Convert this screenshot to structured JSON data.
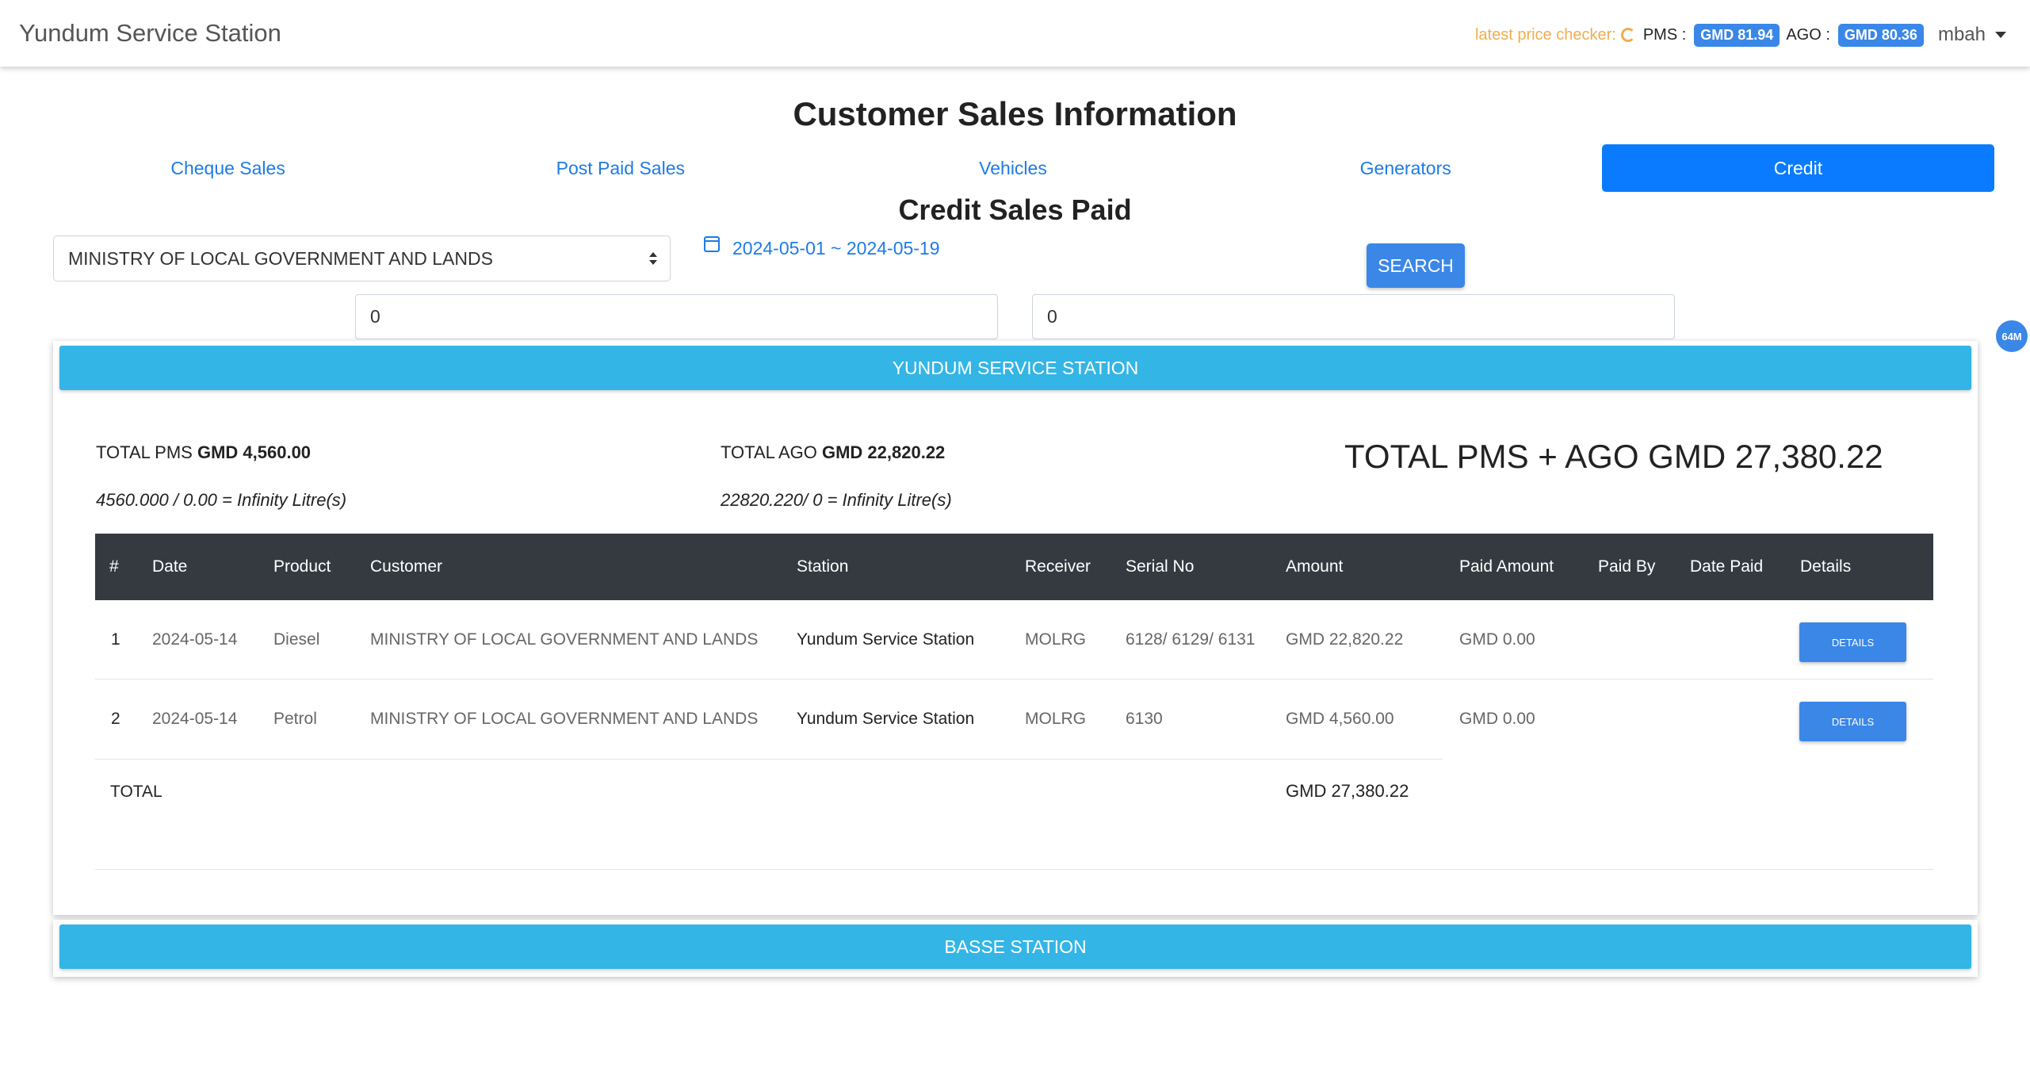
{
  "navbar": {
    "brand": "Yundum Service Station",
    "price_checker_label": "latest price checker:",
    "pms_label": "PMS :",
    "pms_price": "GMD 81.94",
    "ago_label": "AGO :",
    "ago_price": "GMD 80.36",
    "user": "mbah"
  },
  "page": {
    "title": "Customer Sales Information",
    "section_title": "Credit Sales Paid"
  },
  "tabs": [
    {
      "label": "Cheque Sales",
      "active": false
    },
    {
      "label": "Post Paid Sales",
      "active": false
    },
    {
      "label": "Vehicles",
      "active": false
    },
    {
      "label": "Generators",
      "active": false
    },
    {
      "label": "Credit",
      "active": true
    }
  ],
  "filters": {
    "customer": "MINISTRY OF LOCAL GOVERNMENT AND LANDS",
    "date_range": "2024-05-01 ~ 2024-05-19",
    "search_label": "SEARCH",
    "input1_value": "0",
    "input2_value": "0",
    "side_badge": "64M"
  },
  "stations": [
    {
      "name": "YUNDUM SERVICE STATION",
      "total_pms_label": "TOTAL PMS",
      "total_pms_value": "GMD 4,560.00",
      "total_ago_label": "TOTAL AGO",
      "total_ago_value": "GMD 22,820.22",
      "pms_calc": "4560.000 / 0.00 = Infinity Litre(s)",
      "ago_calc": "22820.220/ 0 = Infinity Litre(s)",
      "grand_total": "TOTAL PMS + AGO GMD 27,380.22",
      "columns": [
        "#",
        "Date",
        "Product",
        "Customer",
        "Station",
        "Receiver",
        "Serial No",
        "Amount",
        "Paid Amount",
        "Paid By",
        "Date Paid",
        "Details"
      ],
      "rows": [
        {
          "num": "1",
          "date": "2024-05-14",
          "product": "Diesel",
          "customer": "MINISTRY OF LOCAL GOVERNMENT AND LANDS",
          "station": "Yundum Service Station",
          "receiver": "MOLRG",
          "serial": "6128/ 6129/ 6131",
          "amount": "GMD 22,820.22",
          "paid_amount": "GMD 0.00",
          "paid_by": "",
          "date_paid": "",
          "details_label": "DETAILS"
        },
        {
          "num": "2",
          "date": "2024-05-14",
          "product": "Petrol",
          "customer": "MINISTRY OF LOCAL GOVERNMENT AND LANDS",
          "station": "Yundum Service Station",
          "receiver": "MOLRG",
          "serial": "6130",
          "amount": "GMD 4,560.00",
          "paid_amount": "GMD 0.00",
          "paid_by": "",
          "date_paid": "",
          "details_label": "DETAILS"
        }
      ],
      "total_label": "TOTAL",
      "total_amount": "GMD 27,380.22"
    },
    {
      "name": "BASSE STATION"
    }
  ],
  "colors": {
    "accent": "#0a7bff",
    "station_bar": "#33b5e5",
    "table_header": "#343a40",
    "price_checker": "#f0ad4e"
  }
}
